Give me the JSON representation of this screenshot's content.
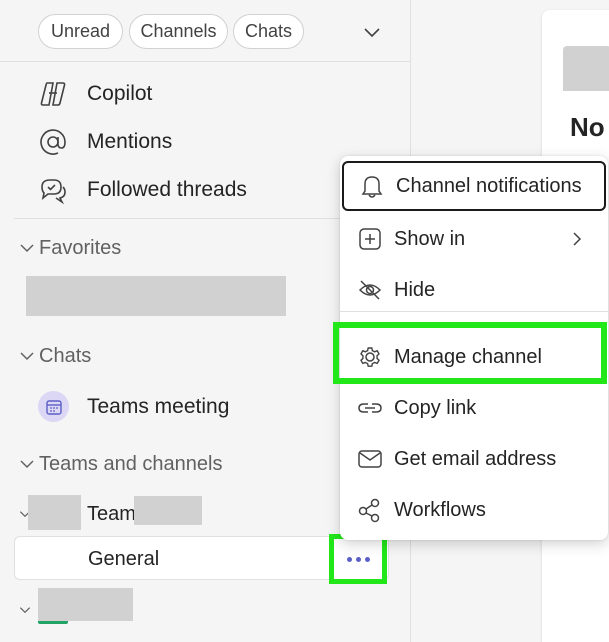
{
  "filters": {
    "chips": [
      "Unread",
      "Channels",
      "Chats"
    ]
  },
  "nav": {
    "copilot": "Copilot",
    "mentions": "Mentions",
    "followed_threads": "Followed threads"
  },
  "sections": {
    "favorites": "Favorites",
    "chats": "Chats",
    "teams_and_channels": "Teams and channels"
  },
  "chats": {
    "teams_meeting": "Teams meeting"
  },
  "team": {
    "name_partial": "Team",
    "channel_general": "General"
  },
  "right_pane": {
    "title_partial": "No"
  },
  "context_menu": {
    "items": [
      {
        "label": "Channel notifications",
        "icon": "bell-icon"
      },
      {
        "label": "Show in",
        "icon": "add-square-icon"
      },
      {
        "label": "Hide",
        "icon": "eye-off-icon"
      },
      {
        "label": "Manage channel",
        "icon": "gear-icon"
      },
      {
        "label": "Copy link",
        "icon": "link-icon"
      },
      {
        "label": "Get email address",
        "icon": "mail-icon"
      },
      {
        "label": "Workflows",
        "icon": "workflows-icon"
      }
    ]
  },
  "colors": {
    "highlight": "#22e81a",
    "accent": "#5b5fc7"
  }
}
